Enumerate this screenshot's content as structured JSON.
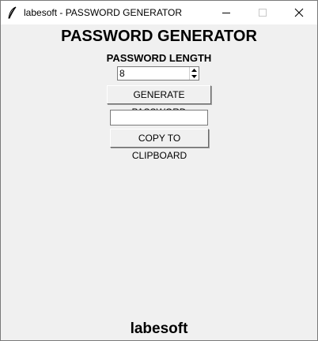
{
  "window": {
    "title": "labesoft - PASSWORD GENERATOR",
    "icons": [
      "feather-icon",
      "minimize-icon",
      "maximize-icon",
      "close-icon"
    ]
  },
  "main": {
    "heading": "PASSWORD GENERATOR",
    "length_label": "PASSWORD LENGTH",
    "length_value": "8",
    "generate_label": "GENERATE PASSWORD",
    "password_output": "",
    "copy_label": "COPY TO CLIPBOARD"
  },
  "footer": {
    "brand": "labesoft"
  }
}
